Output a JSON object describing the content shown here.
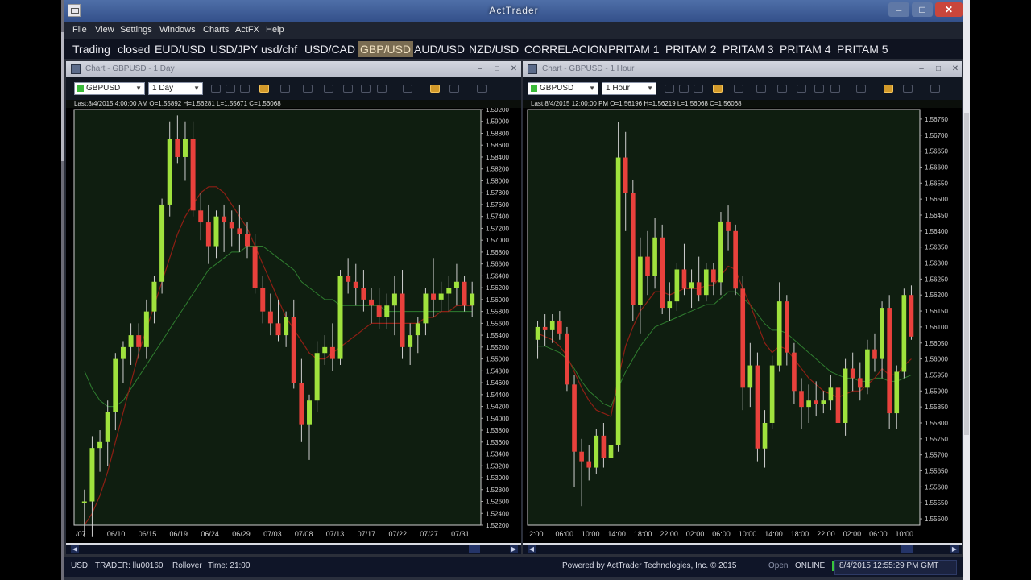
{
  "window": {
    "title": "ActTrader"
  },
  "menu": [
    "File",
    "View",
    "Settings",
    "Windows",
    "Charts",
    "ActFX",
    "Help"
  ],
  "tabs": [
    "Trading",
    "closed",
    "EUD/USD",
    "USD/JPY",
    "usd/chf",
    "USD/CAD",
    "GBP/USD",
    "AUD/USD",
    "NZD/USD",
    "CORRELACION",
    "PRITAM 1",
    "PRITAM 2",
    "PRITAM 3",
    "PRITAM 4",
    "PRITAM 5"
  ],
  "active_tab": "GBP/USD",
  "colors": {
    "bull": "#9fe23d",
    "bear": "#e8413c",
    "ma_fast": "#8d1f14",
    "ma_slow": "#2f7d2f",
    "chart_bg": "#0f1e10",
    "grid_text": "#d0d0d0"
  },
  "charts": [
    {
      "title": "Chart - GBPUSD - 1 Day",
      "symbol": "GBPUSD",
      "timeframe": "1 Day",
      "info": "Last:8/4/2015 4:00:00 AM O=1.55892 H=1.56281 L=1.55671 C=1.56068",
      "price_ticks": [
        "1.59200",
        "1.59000",
        "1.58800",
        "1.58600",
        "1.58400",
        "1.58200",
        "1.58000",
        "1.57800",
        "1.57600",
        "1.57400",
        "1.57200",
        "1.57000",
        "1.56800",
        "1.56600",
        "1.56400",
        "1.56200",
        "1.56000",
        "1.55800",
        "1.55600",
        "1.55400",
        "1.55200",
        "1.55000",
        "1.54800",
        "1.54600",
        "1.54400",
        "1.54200",
        "1.54000",
        "1.53800",
        "1.53600",
        "1.53400",
        "1.53200",
        "1.53000",
        "1.52800",
        "1.52600",
        "1.52400",
        "1.52200"
      ],
      "date_ticks": [
        "/07",
        "06/10",
        "06/15",
        "06/19",
        "06/24",
        "06/29",
        "07/03",
        "07/08",
        "07/13",
        "07/17",
        "07/22",
        "07/27",
        "07/31"
      ]
    },
    {
      "title": "Chart - GBPUSD - 1 Hour",
      "symbol": "GBPUSD",
      "timeframe": "1 Hour",
      "info": "Last:8/4/2015 12:00:00 PM O=1.56196 H=1.56219 L=1.56068 C=1.56068",
      "price_ticks": [
        "1.56750",
        "1.56700",
        "1.56650",
        "1.56600",
        "1.56550",
        "1.56500",
        "1.56450",
        "1.56400",
        "1.56350",
        "1.56300",
        "1.56250",
        "1.56200",
        "1.56150",
        "1.56100",
        "1.56050",
        "1.56000",
        "1.55950",
        "1.55900",
        "1.55850",
        "1.55800",
        "1.55750",
        "1.55700",
        "1.55650",
        "1.55600",
        "1.55550",
        "1.55500"
      ],
      "date_ticks": [
        "2:00",
        "06:00",
        "10:00",
        "14:00",
        "18:00",
        "22:00",
        "02:00",
        "06:00",
        "10:00",
        "14:00",
        "18:00",
        "22:00",
        "02:00",
        "06:00",
        "10:00"
      ]
    }
  ],
  "chart_data": [
    {
      "type": "candlestick",
      "title": "Chart - GBPUSD - 1 Day",
      "ylim": [
        1.522,
        1.592
      ],
      "candles": [
        [
          1.526,
          1.528,
          1.52,
          1.526
        ],
        [
          1.526,
          1.537,
          1.52,
          1.535
        ],
        [
          1.535,
          1.538,
          1.531,
          1.536
        ],
        [
          1.536,
          1.543,
          1.532,
          1.541
        ],
        [
          1.541,
          1.551,
          1.538,
          1.55
        ],
        [
          1.55,
          1.553,
          1.546,
          1.552
        ],
        [
          1.552,
          1.556,
          1.549,
          1.554
        ],
        [
          1.554,
          1.556,
          1.55,
          1.552
        ],
        [
          1.552,
          1.56,
          1.55,
          1.558
        ],
        [
          1.558,
          1.564,
          1.556,
          1.563
        ],
        [
          1.563,
          1.577,
          1.561,
          1.576
        ],
        [
          1.576,
          1.59,
          1.574,
          1.587
        ],
        [
          1.587,
          1.591,
          1.583,
          1.584
        ],
        [
          1.584,
          1.59,
          1.58,
          1.587
        ],
        [
          1.587,
          1.59,
          1.574,
          1.575
        ],
        [
          1.575,
          1.578,
          1.57,
          1.573
        ],
        [
          1.573,
          1.576,
          1.566,
          1.569
        ],
        [
          1.569,
          1.575,
          1.567,
          1.574
        ],
        [
          1.574,
          1.576,
          1.568,
          1.573
        ],
        [
          1.573,
          1.575,
          1.569,
          1.572
        ],
        [
          1.572,
          1.576,
          1.568,
          1.571
        ],
        [
          1.571,
          1.573,
          1.567,
          1.569
        ],
        [
          1.569,
          1.571,
          1.561,
          1.562
        ],
        [
          1.562,
          1.564,
          1.556,
          1.558
        ],
        [
          1.558,
          1.561,
          1.554,
          1.556
        ],
        [
          1.556,
          1.56,
          1.553,
          1.554
        ],
        [
          1.554,
          1.558,
          1.552,
          1.557
        ],
        [
          1.557,
          1.56,
          1.545,
          1.546
        ],
        [
          1.546,
          1.55,
          1.536,
          1.539
        ],
        [
          1.539,
          1.544,
          1.533,
          1.543
        ],
        [
          1.543,
          1.553,
          1.541,
          1.551
        ],
        [
          1.551,
          1.554,
          1.549,
          1.552
        ],
        [
          1.552,
          1.556,
          1.548,
          1.55
        ],
        [
          1.55,
          1.565,
          1.549,
          1.564
        ],
        [
          1.564,
          1.567,
          1.561,
          1.563
        ],
        [
          1.563,
          1.566,
          1.559,
          1.562
        ],
        [
          1.562,
          1.565,
          1.558,
          1.56
        ],
        [
          1.56,
          1.562,
          1.556,
          1.559
        ],
        [
          1.559,
          1.562,
          1.555,
          1.557
        ],
        [
          1.557,
          1.561,
          1.555,
          1.559
        ],
        [
          1.559,
          1.564,
          1.554,
          1.561
        ],
        [
          1.561,
          1.565,
          1.55,
          1.552
        ],
        [
          1.552,
          1.556,
          1.549,
          1.554
        ],
        [
          1.554,
          1.557,
          1.551,
          1.556
        ],
        [
          1.556,
          1.562,
          1.554,
          1.561
        ],
        [
          1.561,
          1.567,
          1.557,
          1.56
        ],
        [
          1.56,
          1.563,
          1.558,
          1.561
        ],
        [
          1.561,
          1.564,
          1.558,
          1.562
        ],
        [
          1.562,
          1.566,
          1.559,
          1.563
        ],
        [
          1.563,
          1.564,
          1.558,
          1.559
        ],
        [
          1.559,
          1.563,
          1.557,
          1.561
        ]
      ],
      "ma_fast": [
        1.522,
        1.524,
        1.527,
        1.531,
        1.536,
        1.541,
        1.546,
        1.551,
        1.555,
        1.559,
        1.563,
        1.567,
        1.571,
        1.574,
        1.576,
        1.578,
        1.579,
        1.579,
        1.578,
        1.576,
        1.574,
        1.572,
        1.569,
        1.566,
        1.563,
        1.56,
        1.557,
        1.555,
        1.553,
        1.551,
        1.55,
        1.55,
        1.551,
        1.552,
        1.553,
        1.554,
        1.555,
        1.556,
        1.556,
        1.556,
        1.556,
        1.556,
        1.556,
        1.556,
        1.557,
        1.557,
        1.558,
        1.558,
        1.559,
        1.559,
        1.559
      ],
      "ma_slow": [
        1.548,
        1.545,
        1.543,
        1.542,
        1.542,
        1.543,
        1.545,
        1.547,
        1.549,
        1.551,
        1.553,
        1.555,
        1.557,
        1.559,
        1.561,
        1.563,
        1.565,
        1.566,
        1.567,
        1.568,
        1.568,
        1.569,
        1.569,
        1.569,
        1.568,
        1.567,
        1.566,
        1.565,
        1.563,
        1.562,
        1.561,
        1.56,
        1.56,
        1.559,
        1.559,
        1.559,
        1.559,
        1.559,
        1.559,
        1.558,
        1.558,
        1.558,
        1.558,
        1.558,
        1.558,
        1.558,
        1.558,
        1.558,
        1.558,
        1.558,
        1.558
      ]
    },
    {
      "type": "candlestick",
      "title": "Chart - GBPUSD - 1 Hour",
      "ylim": [
        1.5548,
        1.5678
      ],
      "candles": [
        [
          1.5606,
          1.5612,
          1.56,
          1.561
        ],
        [
          1.561,
          1.5614,
          1.5604,
          1.5609
        ],
        [
          1.5609,
          1.5614,
          1.5605,
          1.5612
        ],
        [
          1.5612,
          1.5615,
          1.5606,
          1.5608
        ],
        [
          1.5608,
          1.561,
          1.559,
          1.5592
        ],
        [
          1.5592,
          1.5595,
          1.556,
          1.5571
        ],
        [
          1.5571,
          1.5575,
          1.5554,
          1.5568
        ],
        [
          1.5568,
          1.5573,
          1.5562,
          1.5566
        ],
        [
          1.5566,
          1.5578,
          1.5564,
          1.5576
        ],
        [
          1.5576,
          1.558,
          1.5566,
          1.5569
        ],
        [
          1.5569,
          1.5578,
          1.5563,
          1.5573
        ],
        [
          1.5573,
          1.5674,
          1.5571,
          1.5663
        ],
        [
          1.5663,
          1.5671,
          1.564,
          1.5652
        ],
        [
          1.5652,
          1.5656,
          1.5612,
          1.5617
        ],
        [
          1.5617,
          1.5638,
          1.5608,
          1.5632
        ],
        [
          1.5632,
          1.564,
          1.562,
          1.5626
        ],
        [
          1.5626,
          1.5644,
          1.5622,
          1.5638
        ],
        [
          1.5638,
          1.5642,
          1.5614,
          1.5616
        ],
        [
          1.5616,
          1.5624,
          1.5612,
          1.5618
        ],
        [
          1.5618,
          1.563,
          1.5615,
          1.5628
        ],
        [
          1.5628,
          1.5636,
          1.562,
          1.5622
        ],
        [
          1.5622,
          1.5628,
          1.5616,
          1.5624
        ],
        [
          1.5624,
          1.5632,
          1.5618,
          1.562
        ],
        [
          1.562,
          1.563,
          1.5618,
          1.5628
        ],
        [
          1.5628,
          1.563,
          1.562,
          1.5624
        ],
        [
          1.5624,
          1.5646,
          1.562,
          1.5643
        ],
        [
          1.5643,
          1.5648,
          1.5634,
          1.564
        ],
        [
          1.564,
          1.5642,
          1.562,
          1.5622
        ],
        [
          1.5622,
          1.5626,
          1.5584,
          1.5591
        ],
        [
          1.5591,
          1.5605,
          1.5585,
          1.5598
        ],
        [
          1.5598,
          1.5602,
          1.5568,
          1.5572
        ],
        [
          1.5572,
          1.5584,
          1.5566,
          1.558
        ],
        [
          1.558,
          1.5601,
          1.5578,
          1.5598
        ],
        [
          1.5598,
          1.5624,
          1.5596,
          1.5618
        ],
        [
          1.5618,
          1.562,
          1.5598,
          1.5602
        ],
        [
          1.5602,
          1.5605,
          1.5586,
          1.559
        ],
        [
          1.559,
          1.5594,
          1.5578,
          1.5585
        ],
        [
          1.5585,
          1.5592,
          1.558,
          1.5587
        ],
        [
          1.5587,
          1.5593,
          1.5582,
          1.5586
        ],
        [
          1.5586,
          1.559,
          1.5583,
          1.5587
        ],
        [
          1.5587,
          1.5595,
          1.5584,
          1.5591
        ],
        [
          1.5591,
          1.5595,
          1.5576,
          1.558
        ],
        [
          1.558,
          1.56,
          1.5576,
          1.5597
        ],
        [
          1.5597,
          1.5602,
          1.559,
          1.5594
        ],
        [
          1.5594,
          1.5599,
          1.5587,
          1.5591
        ],
        [
          1.5591,
          1.5606,
          1.5589,
          1.5603
        ],
        [
          1.5603,
          1.5608,
          1.5596,
          1.56
        ],
        [
          1.56,
          1.5618,
          1.5594,
          1.5616
        ],
        [
          1.5616,
          1.562,
          1.5578,
          1.5583
        ],
        [
          1.5583,
          1.5598,
          1.5578,
          1.5596
        ],
        [
          1.5596,
          1.5622,
          1.5594,
          1.562
        ],
        [
          1.562,
          1.5623,
          1.5606,
          1.5607
        ]
      ],
      "ma_fast": [
        1.5608,
        1.5607,
        1.5606,
        1.5604,
        1.5601,
        1.5596,
        1.5591,
        1.5587,
        1.5584,
        1.5583,
        1.5582,
        1.5594,
        1.5604,
        1.561,
        1.5615,
        1.5618,
        1.5621,
        1.5621,
        1.562,
        1.5621,
        1.5622,
        1.5622,
        1.5622,
        1.5623,
        1.5623,
        1.5626,
        1.5629,
        1.5628,
        1.5622,
        1.5617,
        1.5611,
        1.5605,
        1.5602,
        1.5604,
        1.5603,
        1.56,
        1.5597,
        1.5594,
        1.5592,
        1.559,
        1.5589,
        1.5588,
        1.5589,
        1.559,
        1.559,
        1.5592,
        1.5594,
        1.5597,
        1.5595,
        1.5595,
        1.5598,
        1.56
      ],
      "ma_slow": [
        1.5604,
        1.5604,
        1.5603,
        1.5602,
        1.56,
        1.5597,
        1.5593,
        1.559,
        1.5588,
        1.5586,
        1.5585,
        1.5591,
        1.5596,
        1.56,
        1.5604,
        1.5607,
        1.561,
        1.5611,
        1.5612,
        1.5613,
        1.5614,
        1.5615,
        1.5616,
        1.5617,
        1.5617,
        1.5619,
        1.5621,
        1.5621,
        1.5619,
        1.5617,
        1.5614,
        1.5611,
        1.5609,
        1.5609,
        1.5608,
        1.5606,
        1.5604,
        1.5602,
        1.56,
        1.5598,
        1.5596,
        1.5595,
        1.5594,
        1.5594,
        1.5593,
        1.5593,
        1.5594,
        1.5594,
        1.5593,
        1.5593,
        1.5594,
        1.5595
      ]
    }
  ],
  "status": {
    "currency": "USD",
    "trader": "TRADER: llu00160",
    "rollover": "Rollover",
    "time": "Time: 21:00",
    "powered": "Powered by ActTrader Technologies, Inc. © 2015",
    "open": "Open",
    "online": "ONLINE",
    "clock": "8/4/2015 12:55:29 PM GMT"
  }
}
